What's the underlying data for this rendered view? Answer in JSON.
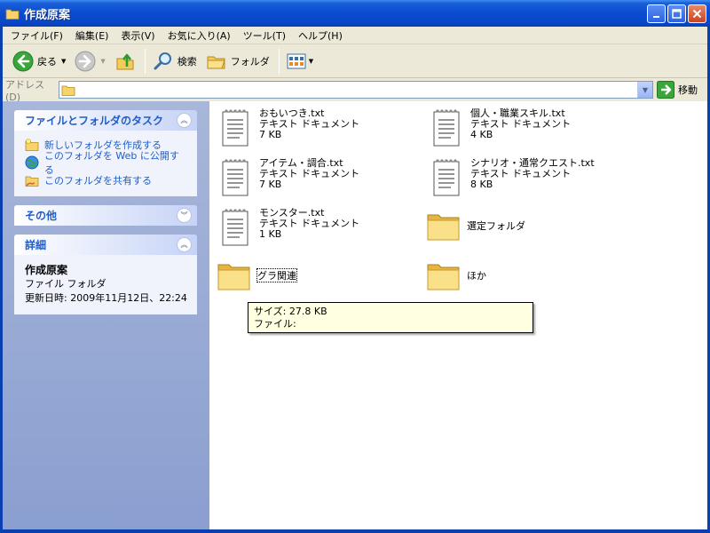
{
  "window": {
    "title": "作成原案"
  },
  "menu": [
    "ファイル(F)",
    "編集(E)",
    "表示(V)",
    "お気に入り(A)",
    "ツール(T)",
    "ヘルプ(H)"
  ],
  "toolbar": {
    "back_label": "戻る",
    "search_label": "検索",
    "folders_label": "フォルダ"
  },
  "address": {
    "label": "アドレス(D)",
    "go_label": "移動"
  },
  "tasks_panel": {
    "title": "ファイルとフォルダのタスク",
    "items": [
      "新しいフォルダを作成する",
      "このフォルダを Web に公開する",
      "このフォルダを共有する"
    ]
  },
  "other_panel": {
    "title": "その他"
  },
  "details_panel": {
    "title": "詳細",
    "name": "作成原案",
    "type": "ファイル フォルダ",
    "modified": "更新日時: 2009年11月12日、22:24"
  },
  "files": [
    {
      "name": "おもいつき.txt",
      "type": "テキスト ドキュメント",
      "size": "7 KB"
    },
    {
      "name": "個人・職業スキル.txt",
      "type": "テキスト ドキュメント",
      "size": "4 KB"
    },
    {
      "name": "アイテム・調合.txt",
      "type": "テキスト ドキュメント",
      "size": "7 KB"
    },
    {
      "name": "シナリオ・通常クエスト.txt",
      "type": "テキスト ドキュメント",
      "size": "8 KB"
    },
    {
      "name": "モンスター.txt",
      "type": "テキスト ドキュメント",
      "size": "1 KB"
    }
  ],
  "folders": [
    {
      "name": "選定フォルダ"
    },
    {
      "name": "グラ関連"
    },
    {
      "name": "ほか"
    }
  ],
  "tooltip": {
    "size": "サイズ: 27.8 KB",
    "files": "ファイル:"
  },
  "colors": {
    "titlebar": "#0a4bd0",
    "task_link": "#215dc6",
    "tooltip_bg": "#ffffe1"
  }
}
